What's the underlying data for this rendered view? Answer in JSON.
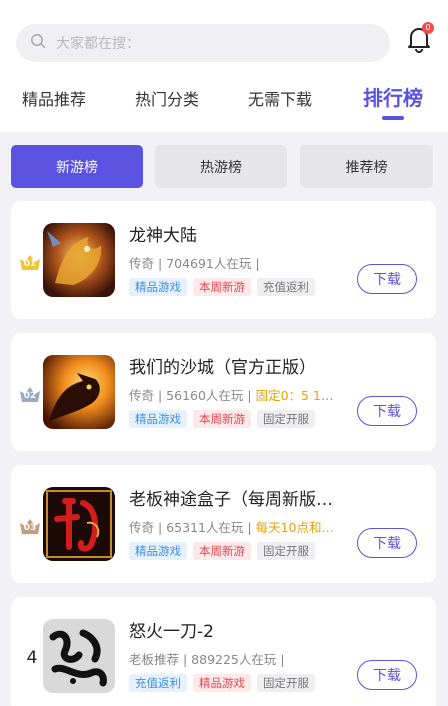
{
  "search": {
    "placeholder": "大家都在搜："
  },
  "notifications": {
    "count": "0"
  },
  "nav_tabs": [
    "精品推荐",
    "热门分类",
    "无需下载",
    "排行榜"
  ],
  "segments": [
    "新游榜",
    "热游榜",
    "推荐榜"
  ],
  "download_label": "下载",
  "games": [
    {
      "rank": "01",
      "name": "龙神大陆",
      "meta": "传奇 | 704691人在玩 |",
      "highlight": "",
      "tags": [
        "精品游戏",
        "本周新游",
        "充值返利"
      ]
    },
    {
      "rank": "02",
      "name": "我们的沙城（官方正版）",
      "meta": "传奇 | 56160人在玩 |",
      "highlight": "固定0：5 10…",
      "tags": [
        "精品游戏",
        "本周新游",
        "固定开服"
      ]
    },
    {
      "rank": "03",
      "name": "老板神途盒子（每周新版…",
      "meta": "传奇 | 65311人在玩 |",
      "highlight": "每天10点和…",
      "tags": [
        "精品游戏",
        "本周新游",
        "固定开服"
      ]
    },
    {
      "rank": "4",
      "name": "怒火一刀-2",
      "meta": "老板推荐 | 889225人在玩 |",
      "highlight": "",
      "tags": [
        "充值返利",
        "精品游戏",
        "固定开服"
      ]
    }
  ],
  "colors": {
    "accent": "#5a52e0",
    "rank1": "#f2c230",
    "rank2": "#9aa8c2",
    "rank3": "#c79c7a"
  }
}
